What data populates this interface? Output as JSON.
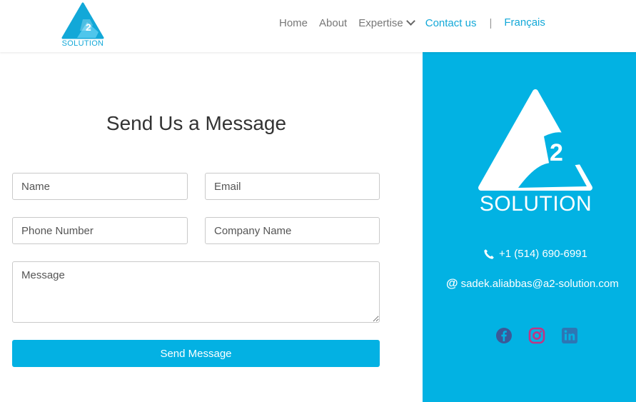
{
  "header": {
    "logo_text": "SOLUTION",
    "logo_mark": "2",
    "nav": [
      {
        "label": "Home"
      },
      {
        "label": "About"
      },
      {
        "label": "Expertise"
      },
      {
        "label": "Contact us"
      }
    ],
    "separator": "|",
    "language": "Français"
  },
  "form": {
    "title": "Send Us a Message",
    "name_placeholder": "Name",
    "email_placeholder": "Email",
    "phone_placeholder": "Phone Number",
    "company_placeholder": "Company Name",
    "message_placeholder": "Message",
    "submit_label": "Send Message"
  },
  "panel": {
    "logo_text": "SOLUTION",
    "logo_mark": "2",
    "phone": "+1 (514) 690-6991",
    "email": "sadek.aliabbas@a2-solution.com",
    "socials": [
      "facebook-icon",
      "instagram-icon",
      "linkedin-icon"
    ]
  },
  "colors": {
    "brand": "#02b2e3",
    "nav_active": "#12a8d8",
    "facebook": "#3b5998",
    "instagram": "#c13584",
    "linkedin": "#2d76b4"
  }
}
